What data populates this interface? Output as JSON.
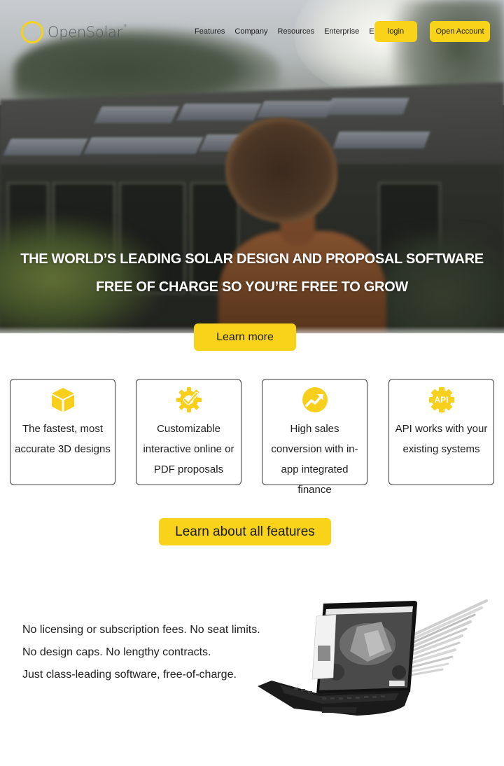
{
  "brand": {
    "name": "OpenSolar",
    "trademark": "®",
    "accent_color": "#f8d31a"
  },
  "nav": {
    "links": [
      "Features",
      "Company",
      "Resources",
      "Enterprise",
      "EN"
    ],
    "login_label": "login",
    "open_account_label": "Open Account"
  },
  "hero": {
    "headline_line1": "THE WORLD’S LEADING SOLAR DESIGN AND PROPOSAL SOFTWARE",
    "headline_line2": "FREE OF CHARGE SO YOU’RE FREE TO GROW",
    "cta_label": "Learn more",
    "image_description": "Woman facing a house with rooftop solar panels"
  },
  "features": {
    "cards": [
      {
        "icon": "cube-icon",
        "text": "The fastest, most accurate 3D designs"
      },
      {
        "icon": "gear-check-icon",
        "text": "Customizable interactive online or PDF proposals"
      },
      {
        "icon": "trending-up-icon",
        "text": "High sales conversion with in-app integrated finance"
      },
      {
        "icon": "api-gear-icon",
        "icon_text": "API",
        "text": "API works with your existing systems"
      }
    ],
    "cta_label": "Learn about all features"
  },
  "promo": {
    "lines": [
      "No licensing or subscription fees. No seat limits.",
      "No design caps. No lengthy contracts.",
      "Just class-leading software, free-of-charge."
    ],
    "image_description": "Laptop showing aerial roof design view"
  }
}
